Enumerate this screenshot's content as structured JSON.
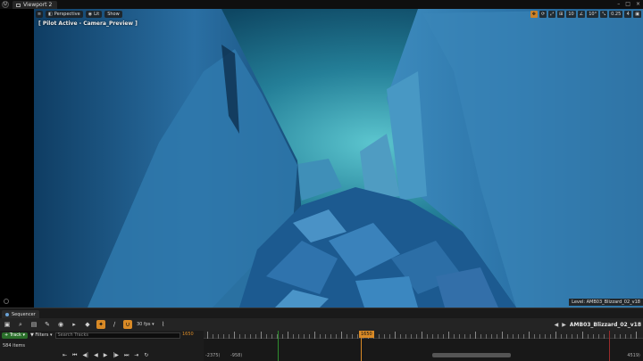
{
  "window": {
    "logo": "U",
    "tab_label": "Viewport 2",
    "controls": [
      "–",
      "□",
      "×"
    ]
  },
  "viewport": {
    "perspective_label": "Perspective",
    "lit_label": "Lit",
    "show_label": "Show",
    "pilot_label": "[ Pilot Active - Camera_Preview ]",
    "level_label": "Level: AMB03_Blizzard_02_v18",
    "right_toolbar": [
      "✥",
      "⟳",
      "⤢",
      "⊞",
      "10",
      "∠",
      "10°",
      "⤡",
      "0.25",
      "4",
      "▣"
    ],
    "scene_colors": {
      "sky": "#1f7f96",
      "glow": "#44b6c4",
      "cliff_light": "#3e86b4",
      "cliff_dark": "#0d3a5c",
      "rock": "#2d6fa8",
      "frame": "#000000"
    }
  },
  "sequencer": {
    "tab_label": "Sequencer",
    "fps_label": "30 fps ▾",
    "sequence_name": "AMB03_Blizzard_02_v18",
    "track_button": "+ Track ▾",
    "filters_label": "▼ Filters ▾",
    "search_placeholder": "Search Tracks",
    "current_frame": "1650",
    "items_count": "584 items",
    "playhead_frame": "1650",
    "range_start": "-2375⟩",
    "range_view": "-958⟩",
    "range_end": "4519⟩",
    "transport": [
      "⇤",
      "⏮",
      "◀|",
      "◀",
      "▶",
      "|▶",
      "⏭",
      "⇥",
      "↻"
    ],
    "toolbar_icons": [
      "save-icon",
      "search-icon",
      "clapper-icon",
      "key-icon",
      "eye-icon",
      "play-icon",
      "snap-icon",
      "brush-icon",
      "magnet-icon",
      "curve-icon"
    ],
    "accent": "#d98a26"
  }
}
